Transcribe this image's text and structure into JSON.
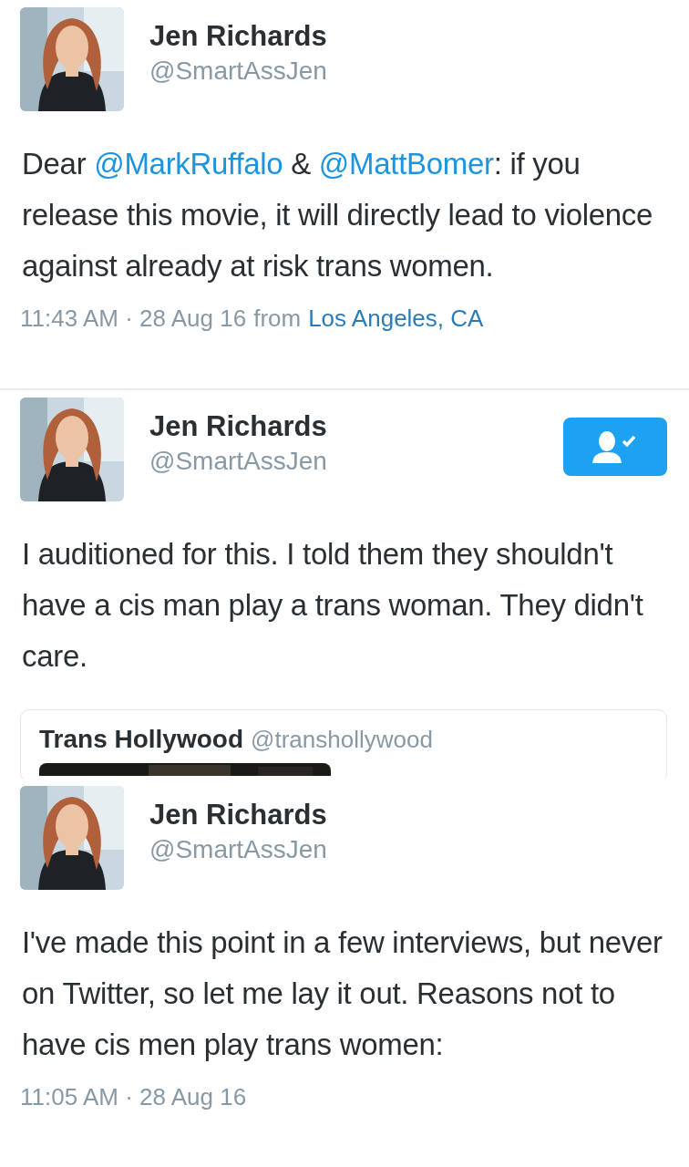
{
  "tweets": [
    {
      "name": "Jen Richards",
      "handle": "@SmartAssJen",
      "body": [
        {
          "kind": "text",
          "text": "Dear "
        },
        {
          "kind": "mention",
          "text": "@MarkRuffalo"
        },
        {
          "kind": "text",
          "text": " & "
        },
        {
          "kind": "mention",
          "text": "@MattBomer"
        },
        {
          "kind": "text",
          "text": ": if you release this movie, it will directly lead to violence against already at risk trans women."
        }
      ],
      "timestamp": "11:43 AM · 28 Aug 16",
      "source_prefix": "from",
      "location": "Los Angeles, CA"
    },
    {
      "name": "Jen Richards",
      "handle": "@SmartAssJen",
      "follow_button": {
        "following": true
      },
      "body": [
        {
          "kind": "text",
          "text": "I auditioned for this. I told them they shouldn't have a cis man play a trans woman. They didn't care."
        }
      ],
      "quoted": {
        "name": "Trans Hollywood",
        "handle": "@transhollywood",
        "kind": "picture"
      }
    },
    {
      "name": "Jen Richards",
      "handle": "@SmartAssJen",
      "body": [
        {
          "kind": "text",
          "text": "I've made this point in a few interviews, but never on Twitter, so let me lay it out. Reasons not to have cis men play trans women:"
        }
      ],
      "timestamp": "11:05 AM · 28 Aug 16"
    }
  ]
}
